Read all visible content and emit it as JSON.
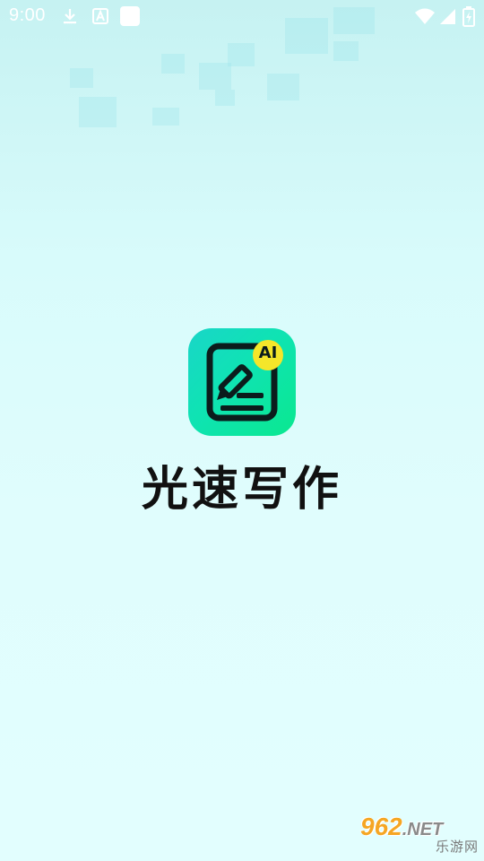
{
  "status_bar": {
    "time": "9:00",
    "icons": [
      "download-icon",
      "a-notification-icon",
      "app-notification-icon",
      "wifi-icon",
      "signal-icon",
      "battery-icon"
    ]
  },
  "splash": {
    "icon_badge": "AI",
    "app_name": "光速写作"
  },
  "watermark": {
    "number": "962",
    "suffix": ".NET",
    "subtitle": "乐游网"
  },
  "colors": {
    "background_top": "#c6f2f2",
    "background_bottom": "#e2fefe",
    "icon_gradient_start": "#19d6c8",
    "icon_gradient_end": "#0ae88f",
    "badge_yellow": "#f5e62a",
    "title_text": "#111111"
  }
}
